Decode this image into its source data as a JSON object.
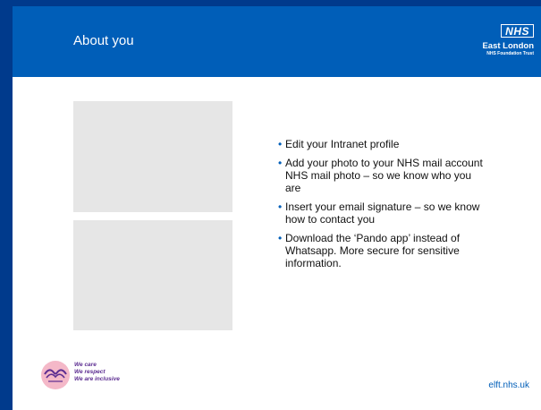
{
  "header": {
    "title": "About you",
    "logo_badge": "NHS",
    "org_name": "East London",
    "org_sub": "NHS Foundation Trust"
  },
  "bullets": [
    "Edit your Intranet profile",
    "Add your photo to your NHS mail account NHS mail photo – so we know who you are",
    "Insert your email signature – so we know how to contact you",
    "Download the ‘Pando app’ instead of Whatsapp. More secure for sensitive information."
  ],
  "footer": {
    "values": [
      "We care",
      "We respect",
      "We are inclusive"
    ],
    "website": "elft.nhs.uk"
  },
  "colors": {
    "nhs_blue": "#005eb8",
    "frame_blue": "#003a8c",
    "placeholder_grey": "#e6e6e6",
    "values_purple": "#5c2d91"
  }
}
